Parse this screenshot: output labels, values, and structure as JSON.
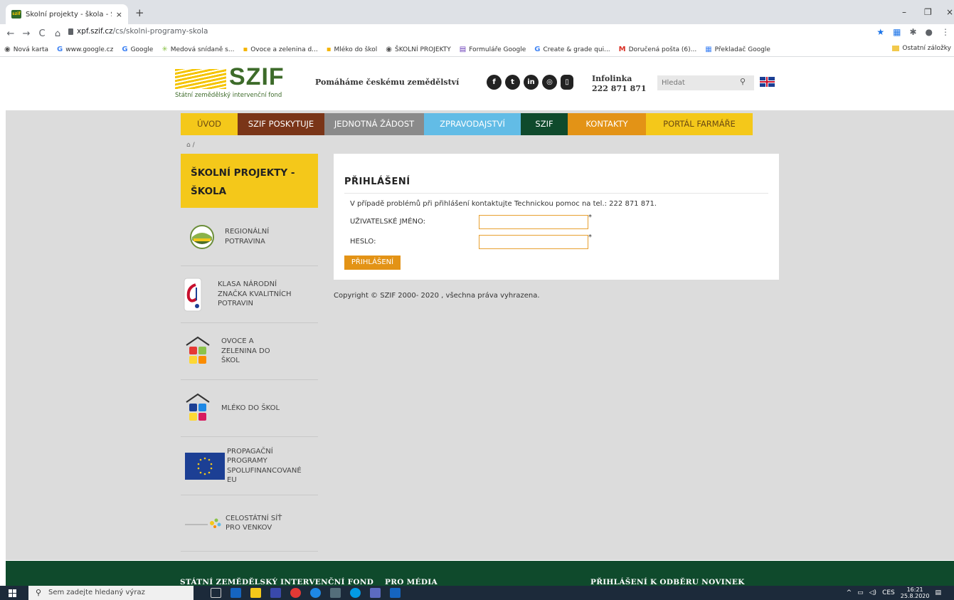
{
  "browser": {
    "tab_title": "Školní projekty - škola - Státní ze",
    "tab_close": "×",
    "new_tab": "+",
    "url_host": "xpf.szif.cz",
    "url_path": "/cs/skolni-programy-skola",
    "win_min": "–",
    "win_max": "❐",
    "win_close": "×",
    "nav_back": "←",
    "nav_forward": "→",
    "nav_reload": "C",
    "nav_home": "⌂",
    "bookmarks": [
      {
        "icon": "◉",
        "label": "Nová karta",
        "color": "#555555"
      },
      {
        "icon": "G",
        "label": "www.google.cz",
        "color": "#4285f4"
      },
      {
        "icon": "G",
        "label": "Google",
        "color": "#4285f4"
      },
      {
        "icon": "✳",
        "label": "Medová snídaně s...",
        "color": "#8bc34a"
      },
      {
        "icon": "▪",
        "label": "Ovoce a zelenina d...",
        "color": "#f4b400"
      },
      {
        "icon": "▪",
        "label": "Mléko do škol",
        "color": "#f4b400"
      },
      {
        "icon": "◉",
        "label": "ŠKOLNÍ PROJEKTY",
        "color": "#555555"
      },
      {
        "icon": "▤",
        "label": "Formuláře Google",
        "color": "#673ab7"
      },
      {
        "icon": "G",
        "label": "Create & grade qui...",
        "color": "#4285f4"
      },
      {
        "icon": "M",
        "label": "Doručená pošta (6)...",
        "color": "#d93025"
      },
      {
        "icon": "▦",
        "label": "Překladač Google",
        "color": "#4285f4"
      }
    ],
    "other_bookmarks": "Ostatní záložky"
  },
  "header": {
    "logo_text": "SZIF",
    "logo_subtitle": "Státní zemědělský intervenční fond",
    "slogan": "Pomáháme českému zemědělství",
    "social": [
      "f",
      "t",
      "in",
      "◎",
      "▯"
    ],
    "infolinka_label": "Infolinka",
    "infolinka_number": "222 871 871",
    "search_placeholder": "Hledat",
    "search_icon": "🔍"
  },
  "nav": [
    {
      "label": "ÚVOD",
      "bg": "#f4c81a",
      "color": "#6b4a12"
    },
    {
      "label": "SZIF POSKYTUJE",
      "bg": "#7a3518",
      "color": "#ffffff"
    },
    {
      "label": "JEDNOTNÁ ŽÁDOST",
      "bg": "#8a8a8a",
      "color": "#ffffff"
    },
    {
      "label": "ZPRAVODAJSTVÍ",
      "bg": "#62bce6",
      "color": "#ffffff"
    },
    {
      "label": "SZIF",
      "bg": "#0f4a2c",
      "color": "#ffffff"
    },
    {
      "label": "KONTAKTY",
      "bg": "#e39316",
      "color": "#ffffff"
    },
    {
      "label": "PORTÁL FARMÁŘE",
      "bg": "#f4c81a",
      "color": "#6b4a12"
    }
  ],
  "breadcrumb": "🏠 /",
  "sidebar": {
    "title": "ŠKOLNÍ PROJEKTY - ŠKOLA",
    "items": [
      {
        "label": "REGIONÁLNÍ POTRAVINA"
      },
      {
        "label": "KLASA NÁRODNÍ ZNAČKA KVALITNÍCH POTRAVIN"
      },
      {
        "label": "OVOCE A ZELENINA DO ŠKOL"
      },
      {
        "label": "MLÉKO DO ŠKOL"
      },
      {
        "label": "PROPAGAČNÍ PROGRAMY SPOLUFINANCOVANÉ EU"
      },
      {
        "label": "CELOSTÁTNÍ SÍŤ PRO VENKOV"
      }
    ]
  },
  "login": {
    "title": "PŘIHLÁŠENÍ",
    "info": "V případě problémů při přihlášení kontaktujte Technickou pomoc na tel.: 222 871 871.",
    "username_label": "UŽIVATELSKÉ JMÉNO:",
    "password_label": "HESLO:",
    "required_mark": "*",
    "username_value": "",
    "password_value": "",
    "submit_label": "PŘIHLÁŠENÍ"
  },
  "copyright": "Copyright © SZIF 2000- 2020 , všechna práva vyhrazena.",
  "footer": {
    "col1": "STÁTNÍ ZEMĚDĚLSKÝ INTERVENČNÍ FOND",
    "col2": "PRO MÉDIA",
    "col3": "PŘIHLÁŠENÍ K ODBĚRU NOVINEK"
  },
  "taskbar": {
    "search_placeholder": "Sem zadejte hledaný výraz",
    "language": "CES",
    "time": "16:21",
    "date": "25.8.2020"
  }
}
